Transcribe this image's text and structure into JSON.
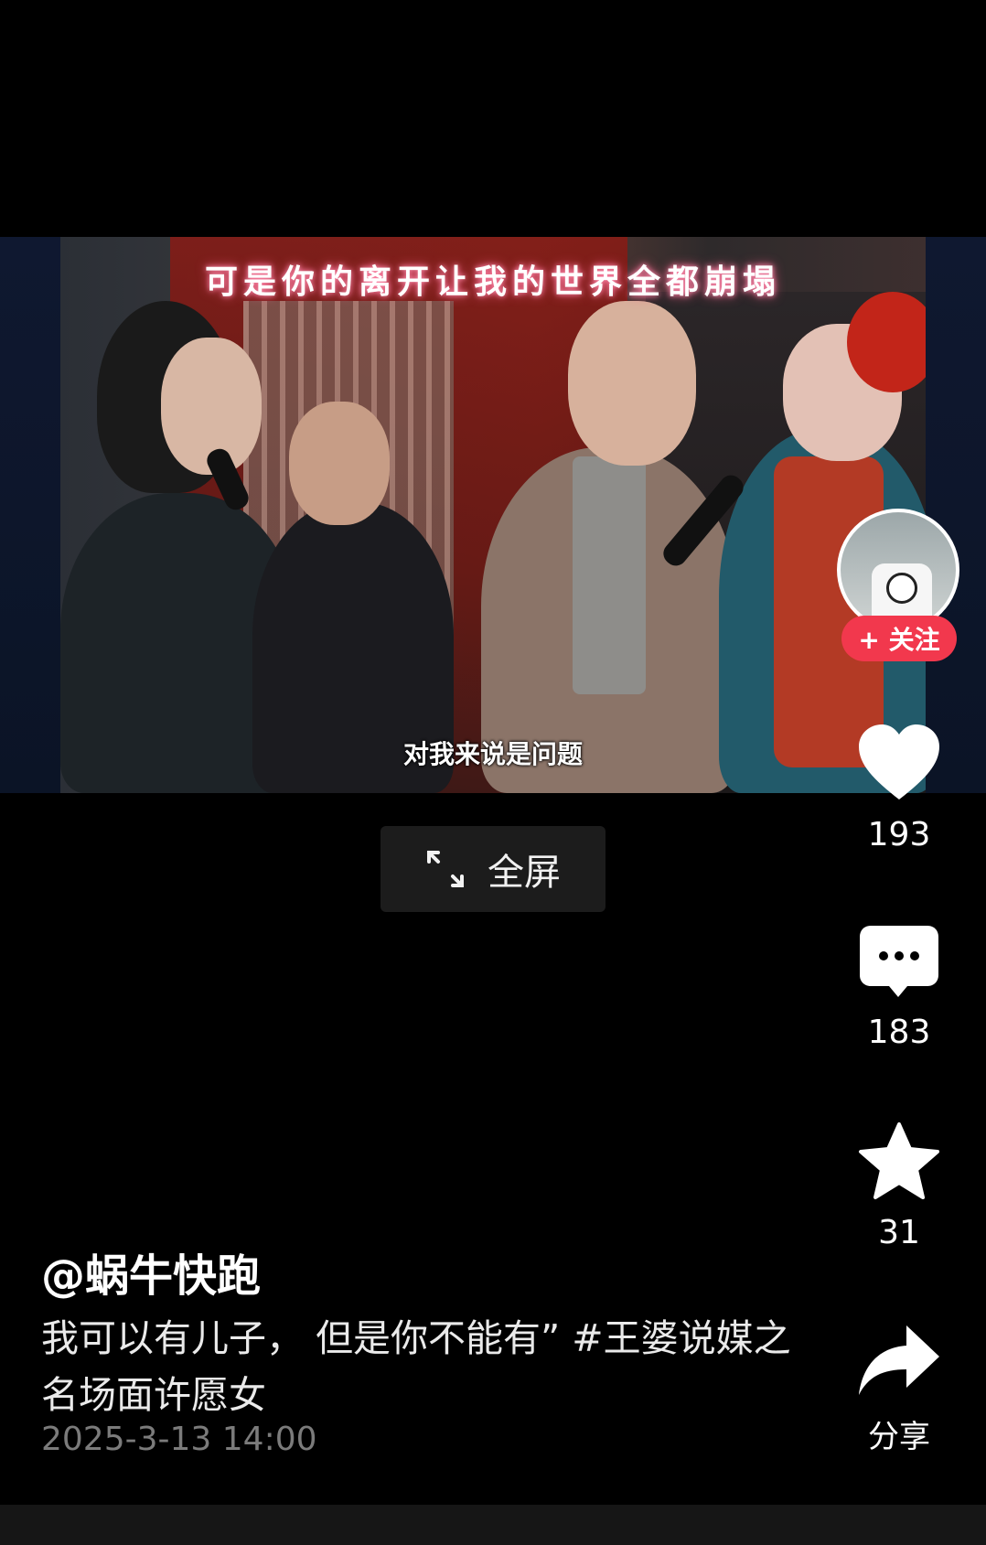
{
  "video": {
    "lyric_overlay": "可是你的离开让我的世界全都崩塌",
    "subtitle": "对我来说是问题"
  },
  "fullscreen": {
    "label": "全屏",
    "icon": "expand-icon"
  },
  "side_bar": {
    "follow_label": "+ 关注",
    "like_count": "193",
    "comment_count": "183",
    "favorite_count": "31",
    "share_label": "分享"
  },
  "post": {
    "author": "@蜗牛快跑",
    "description": "我可以有儿子， 但是你不能有” #王婆说媒之名场面许愿女",
    "timestamp": "2025-3-13 14:00"
  },
  "colors": {
    "follow": "#f2384d",
    "background": "#000000"
  }
}
